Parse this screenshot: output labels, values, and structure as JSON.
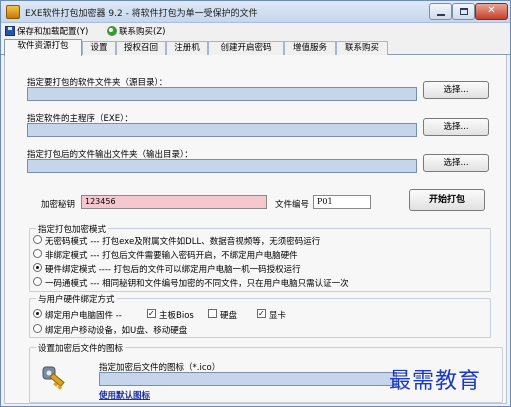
{
  "window": {
    "title": "EXE软件打包加密器 9.2 - 将软件打包为单一受保护的文件",
    "min_label": "",
    "max_label": "",
    "close_label": "✕"
  },
  "menu": {
    "save_config": "保存和加载配置(Y)",
    "contact": "联系购买(Z)"
  },
  "tabs": [
    "软件资源打包",
    "设置",
    "授权召回",
    "注册机",
    "创建开启密码",
    "增值服务",
    "联系购买"
  ],
  "source_dir": {
    "label": "指定要打包的软件文件夹（源目录）：",
    "value": "",
    "browse_label": "选择..."
  },
  "main_exe": {
    "label": "指定软件的主程序（EXE）：",
    "value": "",
    "browse_label": "选择..."
  },
  "output_dir": {
    "label": "指定打包后的文件输出文件夹（输出目录）：",
    "value": "",
    "browse_label": "选择..."
  },
  "encryption": {
    "key_label": "加密秘钥",
    "key_value": "123456",
    "file_id_label": "文件编号",
    "file_id_value": "P01",
    "start_label": "开始打包"
  },
  "pack_mode": {
    "title": "指定打包加密模式",
    "options": [
      {
        "text": "无密码模式 --- 打包exe及附属文件如DLL、数据音视频等，无须密码运行",
        "selected": false
      },
      {
        "text": "非绑定模式 --- 打包后文件需要输入密码开启，不绑定用户电脑硬件",
        "selected": false
      },
      {
        "text": "硬件绑定模式 ---- 打包后的文件可以绑定用户电脑一机一码授权运行",
        "selected": true
      },
      {
        "text": "一码通模式 --- 相同秘钥和文件编号加密的不同文件，只在用户电脑只需认证一次",
        "selected": false
      }
    ]
  },
  "hardware_bind": {
    "title": "与用户硬件绑定方式",
    "bind_pc_label": "绑定用户电脑固件 --",
    "bind_pc_selected": true,
    "checks": [
      {
        "text": "主板Bios",
        "checked": true
      },
      {
        "text": "硬盘",
        "checked": false
      },
      {
        "text": "显卡",
        "checked": true
      }
    ],
    "bind_mobile_label": "绑定用户移动设备，如U盘、移动硬盘",
    "bind_mobile_selected": false
  },
  "icon_settings": {
    "title": "设置加密后文件的图标",
    "icon_label": "指定加密后文件的图标（*.ico）",
    "icon_value": "",
    "default_icon_link": "使用默认图标"
  },
  "watermark": {
    "text": "最需教育"
  },
  "colors": {
    "accent_input": "#c5d6ec",
    "key_input": "#f7c7cf",
    "link": "#1b2fa8",
    "watermark": "#1b39c8"
  }
}
